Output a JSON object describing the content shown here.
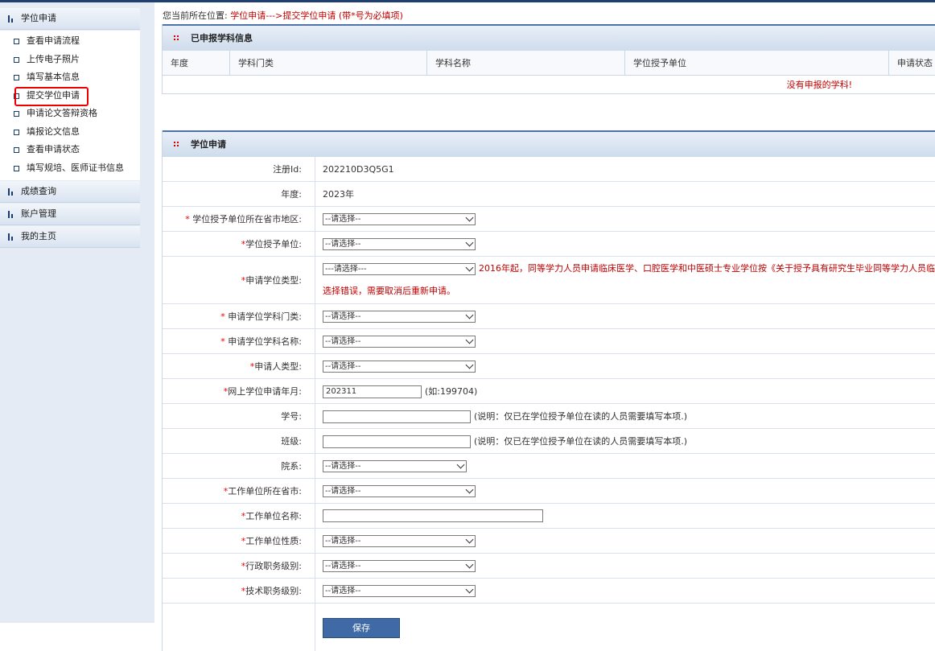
{
  "sidebar": {
    "sections": [
      {
        "title": "学位申请",
        "items": [
          "查看申请流程",
          "上传电子照片",
          "填写基本信息",
          "提交学位申请",
          "申请论文答辩资格",
          "填报论文信息",
          "查看申请状态",
          "填写规培、医师证书信息"
        ]
      },
      {
        "title": "成绩查询"
      },
      {
        "title": "账户管理"
      },
      {
        "title": "我的主页"
      }
    ]
  },
  "breadcrumb": {
    "label": "您当前所在位置:",
    "path": "学位申请--->提交学位申请 (带*号为必填项)"
  },
  "applied_panel": {
    "title": "已申报学科信息",
    "columns": [
      "年度",
      "学科门类",
      "学科名称",
      "学位授予单位",
      "申请状态"
    ],
    "empty_text": "没有申报的学科!"
  },
  "form_panel": {
    "title": "学位申请",
    "select_placeholder": "--请选择--",
    "select_placeholder2": "---请选择---",
    "rows": {
      "reg_id": {
        "label": "注册Id:",
        "value": "202210D3Q5G1"
      },
      "year": {
        "label": "年度:",
        "value": "2023年"
      },
      "unit_region": {
        "label": "学位授予单位所在省市地区:"
      },
      "unit": {
        "label": "学位授予单位:"
      },
      "degree_type": {
        "label": "申请学位类型:",
        "note1": "2016年起，同等学力人员申请临床医学、口腔医学和中医硕士专业学位按《关于授予具有研究生毕业同等学力人员临",
        "note2": "选择错误，需要取消后重新申请。"
      },
      "subject_cat": {
        "label": "申请学位学科门类:"
      },
      "subject_name": {
        "label": "申请学位学科名称:"
      },
      "applicant_type": {
        "label": "申请人类型:"
      },
      "apply_month": {
        "label": "网上学位申请年月:",
        "value": "202311",
        "hint": "(如:199704)"
      },
      "student_no": {
        "label": "学号:",
        "hint": "(说明：仅已在学位授予单位在读的人员需要填写本项.)"
      },
      "class_name": {
        "label": "班级:",
        "hint": "(说明：仅已在学位授予单位在读的人员需要填写本项.)"
      },
      "department": {
        "label": "院系:"
      },
      "work_city": {
        "label": "工作单位所在省市:"
      },
      "work_name": {
        "label": "工作单位名称:"
      },
      "work_nature": {
        "label": "工作单位性质:"
      },
      "admin_level": {
        "label": "行政职务级别:"
      },
      "tech_level": {
        "label": "技术职务级别:"
      }
    },
    "save_label": "保存",
    "req_mark": "*"
  }
}
